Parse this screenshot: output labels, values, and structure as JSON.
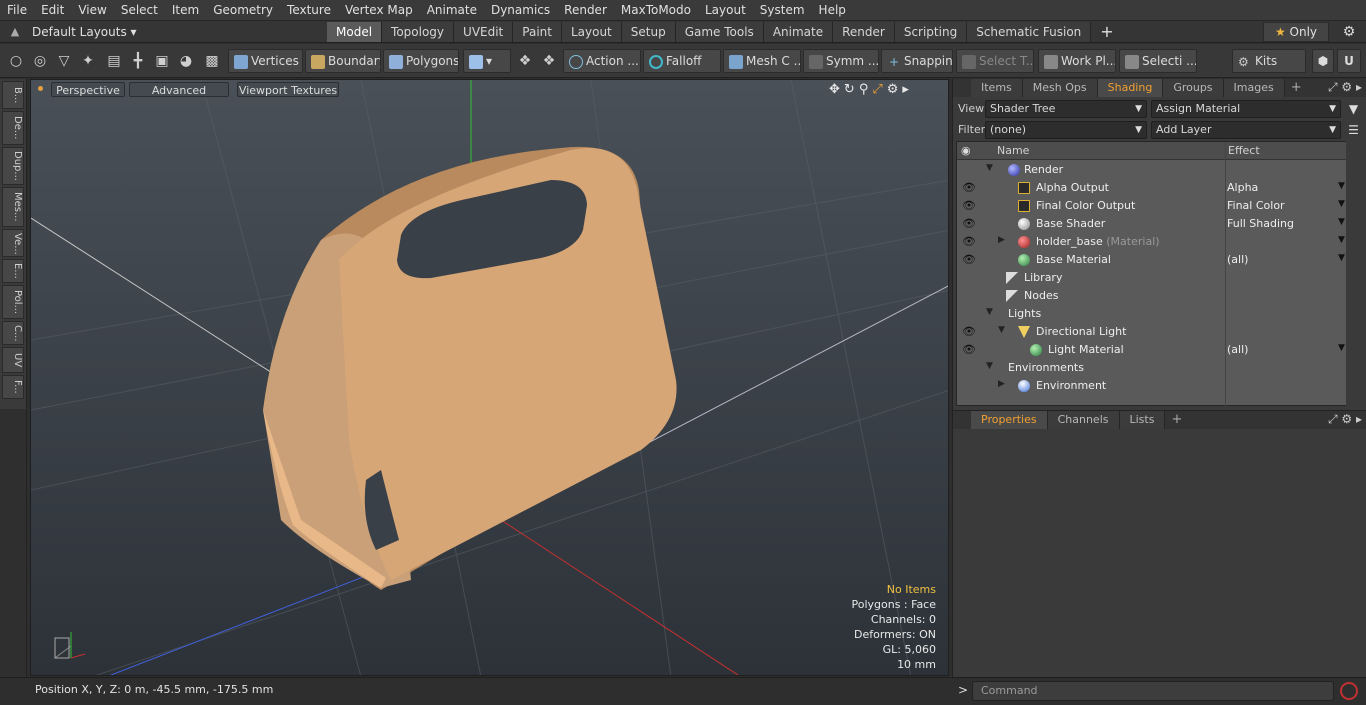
{
  "menu": [
    "File",
    "Edit",
    "View",
    "Select",
    "Item",
    "Geometry",
    "Texture",
    "Vertex Map",
    "Animate",
    "Dynamics",
    "Render",
    "MaxToModo",
    "Layout",
    "System",
    "Help"
  ],
  "layout": {
    "default_layouts": "Default Layouts",
    "tabs": [
      "Model",
      "Topology",
      "UVEdit",
      "Paint",
      "Layout",
      "Setup",
      "Game Tools",
      "Animate",
      "Render",
      "Scripting",
      "Schematic Fusion"
    ],
    "active_tab": "Model",
    "only_label": "Only"
  },
  "toolbar": {
    "vertices": "Vertices",
    "boundary": "Boundary",
    "polygons": "Polygons",
    "action": "Action",
    "falloff": "Falloff",
    "mesh": "Mesh C ...",
    "symm": "Symm ...",
    "snapping": "Snapping",
    "select_t": "Select T...",
    "work_pl": "Work Pl...",
    "selecti": "Selecti ...",
    "kits": "Kits"
  },
  "left_tabs": [
    "B...",
    "De...",
    "Dup...",
    "Mes...",
    "Ve...",
    "E...",
    "Pol...",
    "C...",
    "UV",
    "F..."
  ],
  "viewport": {
    "perspective": "Perspective",
    "advanced": "Advanced",
    "viewport_textures": "Viewport Textures",
    "info": {
      "no_items": "No Items",
      "polygons": "Polygons : Face",
      "channels": "Channels: 0",
      "deformers": "Deformers: ON",
      "gl": "GL: 5,060",
      "scale": "10 mm"
    }
  },
  "status": {
    "position": "Position X, Y, Z:   0 m, -45.5 mm, -175.5 mm"
  },
  "right_panel": {
    "tabs": [
      "Items",
      "Mesh Ops",
      "Shading",
      "Groups",
      "Images"
    ],
    "active_tab": "Shading",
    "view_label": "View",
    "view_value": "Shader Tree",
    "assign_material": "Assign Material",
    "filter_label": "Filter",
    "filter_value": "(none)",
    "add_layer": "Add Layer",
    "col_name": "Name",
    "col_effect": "Effect",
    "tree": [
      {
        "name": "Render",
        "effect": ""
      },
      {
        "name": "Alpha Output",
        "effect": "Alpha"
      },
      {
        "name": "Final Color Output",
        "effect": "Final Color"
      },
      {
        "name": "Base Shader",
        "effect": "Full Shading"
      },
      {
        "name": "holder_base",
        "suffix": "(Material)",
        "effect": ""
      },
      {
        "name": "Base Material",
        "effect": "(all)"
      },
      {
        "name": "Library",
        "effect": ""
      },
      {
        "name": "Nodes",
        "effect": ""
      },
      {
        "name": "Lights",
        "effect": ""
      },
      {
        "name": "Directional Light",
        "effect": ""
      },
      {
        "name": "Light Material",
        "effect": "(all)"
      },
      {
        "name": "Environments",
        "effect": ""
      },
      {
        "name": "Environment",
        "effect": ""
      }
    ]
  },
  "props_panel": {
    "tabs": [
      "Properties",
      "Channels",
      "Lists"
    ],
    "active_tab": "Properties"
  },
  "command": {
    "placeholder": "Command"
  },
  "colors": {
    "accent_orange": "#f0a030",
    "object_tan": "#d4a070"
  }
}
